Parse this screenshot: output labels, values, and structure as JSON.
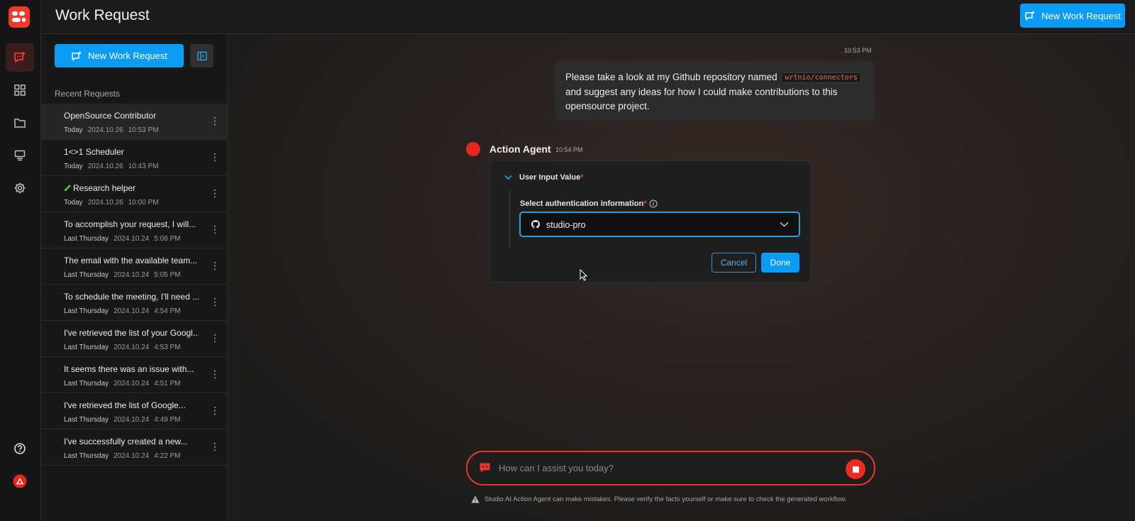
{
  "app": {
    "brand_color": "#f0392b",
    "accent_color": "#0a9cf5"
  },
  "header": {
    "title": "Work Request",
    "new_button_label": "New Work Request"
  },
  "rail": {
    "items": [
      {
        "icon": "work-request-icon",
        "active": true
      },
      {
        "icon": "grid-icon",
        "active": false
      },
      {
        "icon": "folder-icon",
        "active": false
      },
      {
        "icon": "template-icon",
        "active": false
      },
      {
        "icon": "gear-icon",
        "active": false
      }
    ],
    "bottom": [
      "help-icon",
      "avatar"
    ]
  },
  "sidebar": {
    "new_button_label": "New Work Request",
    "recent_label": "Recent Requests",
    "items": [
      {
        "title": "OpenSource Contributor",
        "day": "Today",
        "date": "2024.10.26",
        "time": "10:53 PM",
        "active": true
      },
      {
        "title": "1<>1 Scheduler",
        "day": "Today",
        "date": "2024.10.26",
        "time": "10:43 PM"
      },
      {
        "title": "Research helper",
        "day": "Today",
        "date": "2024.10.26",
        "time": "10:00 PM",
        "icon": "pencil-icon"
      },
      {
        "title": "To accomplish your request, I will...",
        "day": "Last Thursday",
        "date": "2024.10.24",
        "time": "5:08 PM"
      },
      {
        "title": "The email with the available team...",
        "day": "Last Thursday",
        "date": "2024.10.24",
        "time": "5:05 PM"
      },
      {
        "title": "To schedule the meeting, I'll need ...",
        "day": "Last Thursday",
        "date": "2024.10.24",
        "time": "4:54 PM"
      },
      {
        "title": "I've retrieved the list of your Googl...",
        "day": "Last Thursday",
        "date": "2024.10.24",
        "time": "4:53 PM"
      },
      {
        "title": "It seems there was an issue with...",
        "day": "Last Thursday",
        "date": "2024.10.24",
        "time": "4:51 PM"
      },
      {
        "title": "I've retrieved the list of Google...",
        "day": "Last Thursday",
        "date": "2024.10.24",
        "time": "4:49 PM"
      },
      {
        "title": "I've successfully created a new...",
        "day": "Last Thursday",
        "date": "2024.10.24",
        "time": "4:22 PM"
      }
    ]
  },
  "chat": {
    "user_message": {
      "time": "10:53 PM",
      "text_before": "Please take a look at my Github repository named",
      "code": "wrtnio/connectors",
      "text_after": "and suggest any ideas for how I could make contributions to this opensource project."
    },
    "agent": {
      "name": "Action Agent",
      "time": "10:54 PM",
      "card": {
        "section_title": "User Input Value",
        "required_mark": "*",
        "field_label": "Select authentication information",
        "selected_value": "studio-pro",
        "cancel_label": "Cancel",
        "done_label": "Done"
      }
    },
    "input_placeholder": "How can I assist you today?",
    "disclaimer": "Studio AI Action Agent can make mistakes. Please verify the facts yourself or make sure to check the generated workflow."
  }
}
